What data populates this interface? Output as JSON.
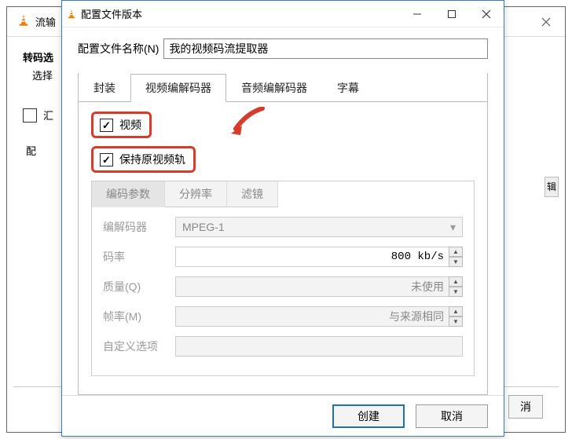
{
  "bg": {
    "title_partial": "流输",
    "heading": "转码选",
    "sub": "选择",
    "chk_partial": "汇",
    "btn_partial": "辑",
    "cancel_partial": "消",
    "config_partial": "配"
  },
  "dialog": {
    "title": "配置文件版本",
    "name_label": "配置文件名称(N)",
    "name_value": "我的视频码流提取器",
    "tabs": [
      "封装",
      "视频编解码器",
      "音频编解码器",
      "字幕"
    ],
    "video": {
      "chk1": "视频",
      "chk2": "保持原视频轨",
      "inner_tabs": [
        "编码参数",
        "分辨率",
        "滤镜"
      ],
      "rows": {
        "codec_label": "编解码器",
        "codec_value": "MPEG-1",
        "bitrate_label": "码率",
        "bitrate_value": "800 kb/s",
        "quality_label": "质量(Q)",
        "quality_value": "未使用",
        "framerate_label": "帧率(M)",
        "framerate_value": "与来源相同",
        "custom_label": "自定义选项"
      }
    },
    "footer": {
      "create": "创建",
      "cancel": "取消"
    }
  }
}
